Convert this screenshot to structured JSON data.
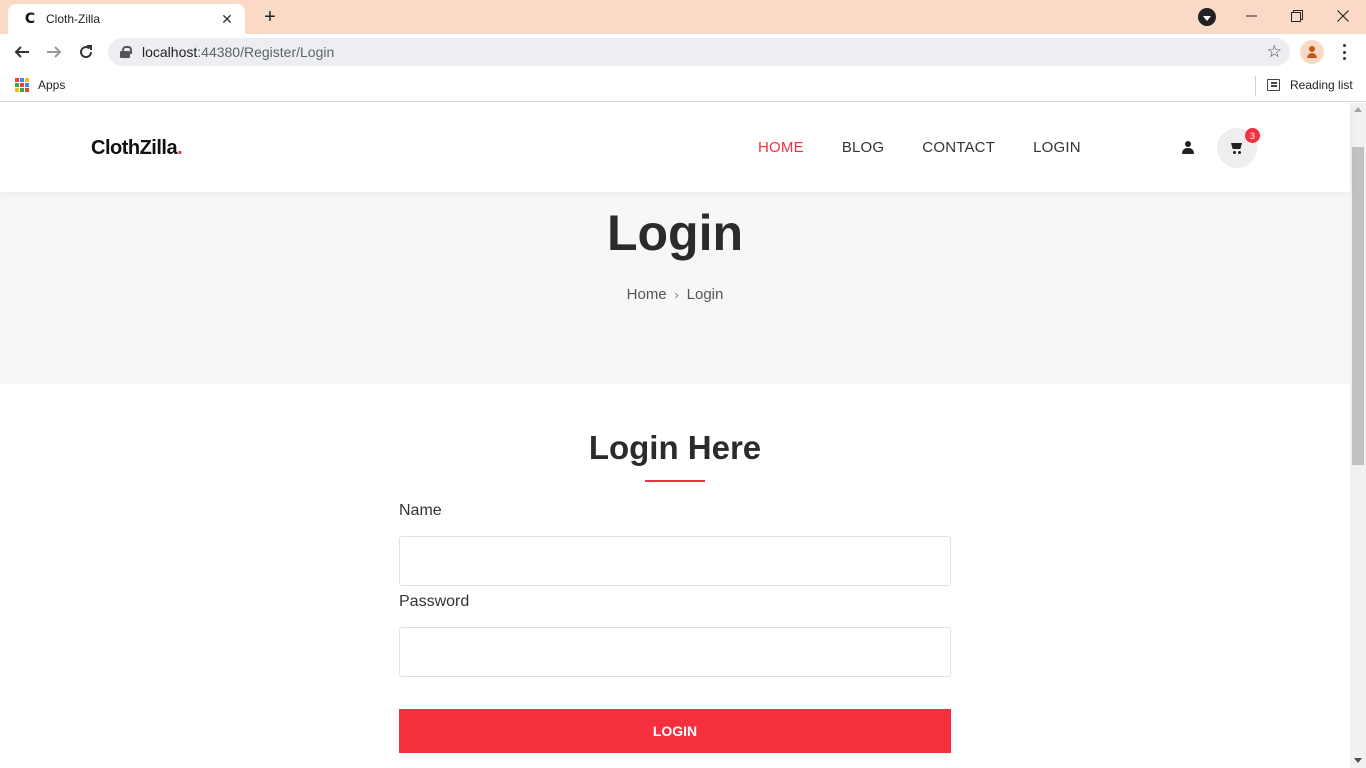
{
  "browser": {
    "tab_title": "Cloth-Zilla",
    "tab_favicon": "C",
    "new_tab_label": "+",
    "url_host": "localhost",
    "url_rest": ":44380/Register/Login",
    "bookmarks": {
      "apps_label": "Apps",
      "reading_list_label": "Reading list"
    },
    "icons": [
      "back-icon",
      "forward-icon",
      "reload-icon",
      "lock-icon",
      "star-icon",
      "avatar-icon",
      "kebab-menu-icon",
      "minimize-icon",
      "restore-icon",
      "close-icon"
    ]
  },
  "site": {
    "logo": {
      "text": "ClothZilla",
      "dot": "."
    },
    "nav": [
      {
        "label": "HOME",
        "active": true
      },
      {
        "label": "BLOG",
        "active": false
      },
      {
        "label": "CONTACT",
        "active": false
      },
      {
        "label": "LOGIN",
        "active": false
      }
    ],
    "cart_count": "3",
    "accent_color": "#f4303f"
  },
  "hero": {
    "title": "Login",
    "breadcrumb": [
      "Home",
      "Login"
    ]
  },
  "form": {
    "title": "Login Here",
    "name_label": "Name",
    "name_value": "",
    "password_label": "Password",
    "password_value": "",
    "submit_label": "LOGIN"
  }
}
